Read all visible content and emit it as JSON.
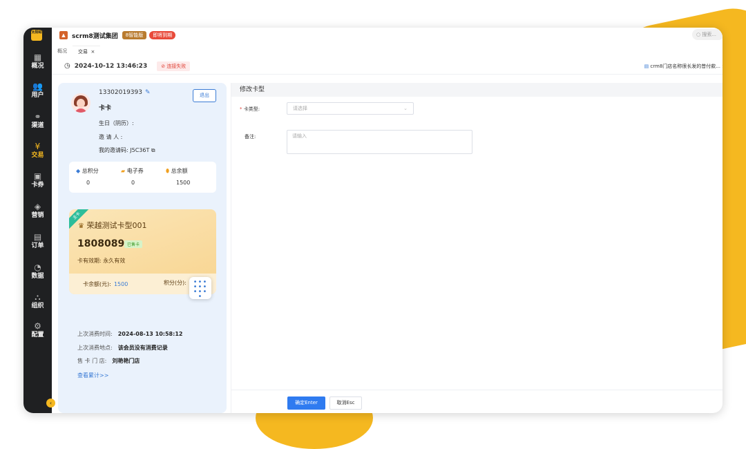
{
  "app": {
    "logo_text": "太阳码",
    "org_name": "scrm8测试集团",
    "version_badge": "8智能版",
    "expire_badge": "即将到期",
    "search_placeholder": "搜索..."
  },
  "sidebar": {
    "items": [
      {
        "label": "概况",
        "icon": "dashboard-icon",
        "glyph": "▦"
      },
      {
        "label": "用户",
        "icon": "users-icon",
        "glyph": "👥"
      },
      {
        "label": "渠道",
        "icon": "channel-icon",
        "glyph": "⚭"
      },
      {
        "label": "交易",
        "icon": "trade-icon",
        "glyph": "¥"
      },
      {
        "label": "卡券",
        "icon": "coupon-icon",
        "glyph": "▣"
      },
      {
        "label": "营销",
        "icon": "marketing-icon",
        "glyph": "◈"
      },
      {
        "label": "订单",
        "icon": "order-icon",
        "glyph": "▤"
      },
      {
        "label": "数据",
        "icon": "data-icon",
        "glyph": "◔"
      },
      {
        "label": "组织",
        "icon": "org-icon",
        "glyph": "⛬"
      },
      {
        "label": "配置",
        "icon": "settings-icon",
        "glyph": "⚙"
      }
    ],
    "active_index": 3
  },
  "tabs": [
    {
      "label": "概况"
    },
    {
      "label": "交易",
      "close": "×"
    }
  ],
  "subbar": {
    "datetime": "2024-10-12 13:46:23",
    "connection_status": "连接失败",
    "store_link": "crm8门店名称很长发的昔付款..."
  },
  "member": {
    "phone": "13302019393",
    "name": "卡卡",
    "birthday_label": "生日（阴历）:",
    "inviter_label": "邀 请 人 :",
    "invite_code_label": "我的邀请码:",
    "invite_code": "J5C36T",
    "logout_label": "退出",
    "stats": [
      {
        "label": "总积分",
        "value": "0",
        "icon": "points-icon",
        "color": "#3a7bd5"
      },
      {
        "label": "电子券",
        "value": "0",
        "icon": "voucher-icon",
        "color": "#f0a020"
      },
      {
        "label": "总余额",
        "value": "1500",
        "icon": "balance-icon",
        "color": "#f0a020"
      }
    ]
  },
  "card": {
    "ribbon": "主卡",
    "title": "荣越测试卡型001",
    "number": "1808089",
    "status": "已售卡",
    "validity": "卡有效期: 永久有效",
    "balance_label": "卡余额(元):",
    "balance_value": "1500",
    "points_label": "积分(分):"
  },
  "consumption": {
    "rows": [
      {
        "key": "上次消费时间:",
        "value": "2024-08-13 10:58:12"
      },
      {
        "key": "上次消费地点:",
        "value": "该会员没有消费记录"
      },
      {
        "key": "售 卡 门 店:",
        "value": "刘艳艳门店"
      }
    ],
    "view_more": "查看累计>>"
  },
  "form": {
    "title": "修改卡型",
    "card_type_label": "卡类型:",
    "card_type_placeholder": "请选择",
    "remark_label": "备注:",
    "remark_placeholder": "请输入",
    "confirm_label": "确定Enter",
    "cancel_label": "取消Esc"
  }
}
